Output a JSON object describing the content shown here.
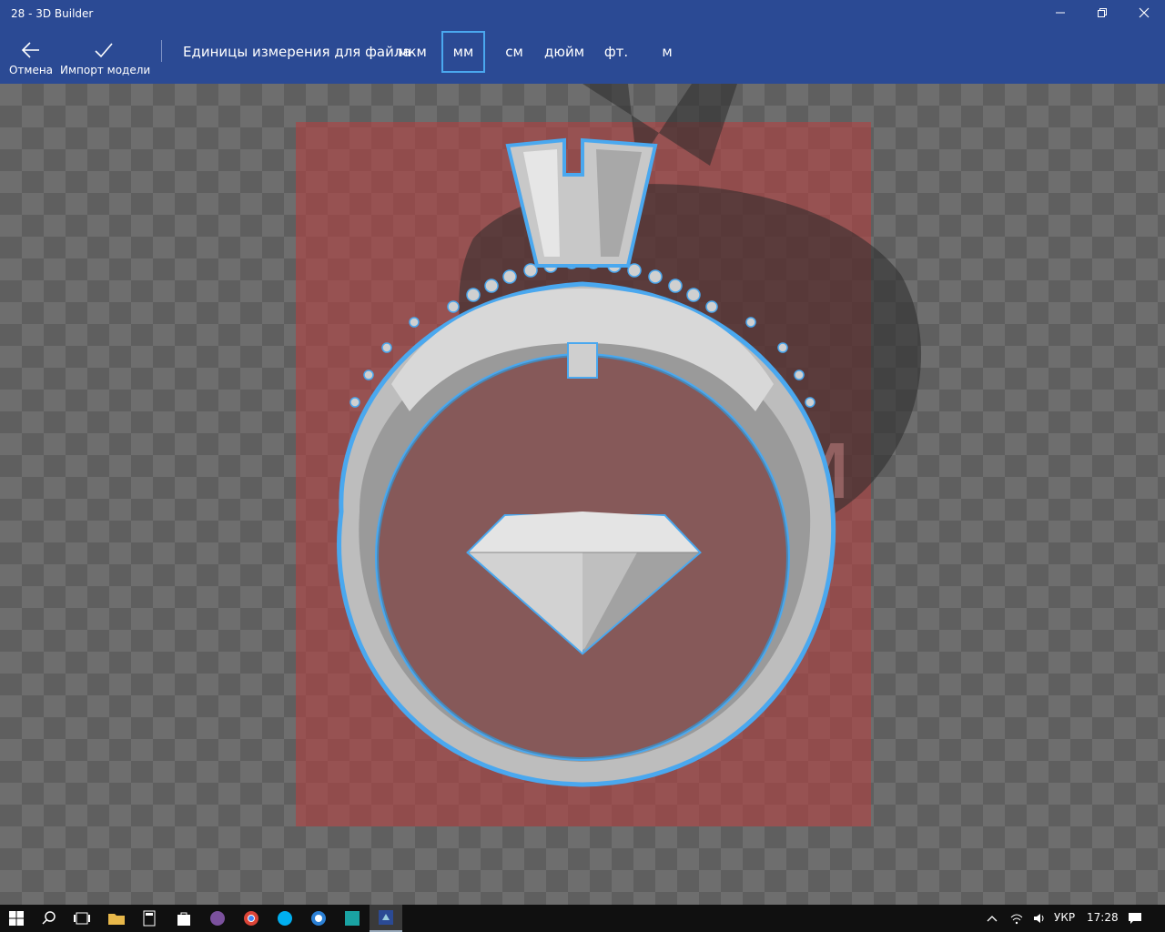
{
  "window": {
    "title": "28 - 3D Builder"
  },
  "toolbar": {
    "cancel_label": "Отмена",
    "import_label": "Импорт модели",
    "units_label": "Единицы измерения для файла",
    "units": [
      "мкм",
      "мм",
      "см",
      "дюйм",
      "фт.",
      "м"
    ],
    "selected_unit": "мм"
  },
  "canvas": {
    "dimension_text": "0 мм"
  },
  "taskbar": {
    "language": "УКР",
    "time": "17:28"
  },
  "colors": {
    "accent": "#2b4a94",
    "selection": "#4aa8ef",
    "bounds": "#b04040"
  }
}
